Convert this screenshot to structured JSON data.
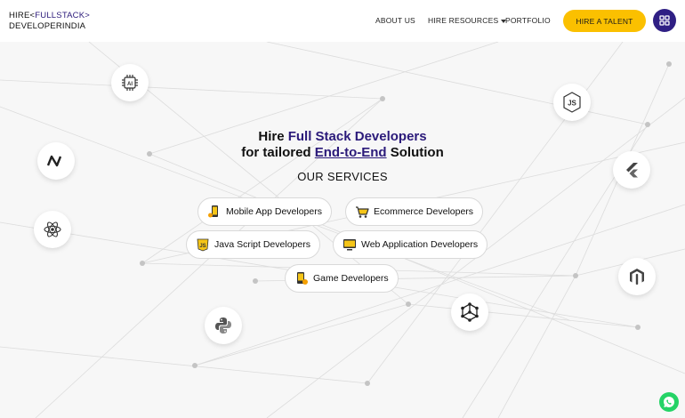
{
  "header": {
    "logo_line1_prefix": "HIRE<",
    "logo_line1_accent": "FULLSTACK",
    "logo_line1_suffix": ">",
    "logo_line2": "DEVELOPERINDIA",
    "nav": {
      "about": "ABOUT US",
      "hire_resources": "HIRE RESOURCES",
      "portfolio": "PORTFOLIO"
    },
    "cta": "HIRE A TALENT"
  },
  "hero": {
    "line1_prefix": "Hire ",
    "line1_accent": "Full Stack Developers",
    "line2_prefix": "for tailored ",
    "line2_accent": "End-to-End",
    "line2_suffix": " Solution",
    "services_title": "OUR SERVICES"
  },
  "services": {
    "mobile": "Mobile App Developers",
    "ecommerce": "Ecommerce Developers",
    "javascript": "Java Script Developers",
    "webapp": "Web Application Developers",
    "game": "Game Developers"
  },
  "tech_icons": {
    "ai_label": "AI"
  },
  "colors": {
    "accent": "#2b1a7a",
    "cta": "#fbc000",
    "whatsapp": "#25d366"
  }
}
